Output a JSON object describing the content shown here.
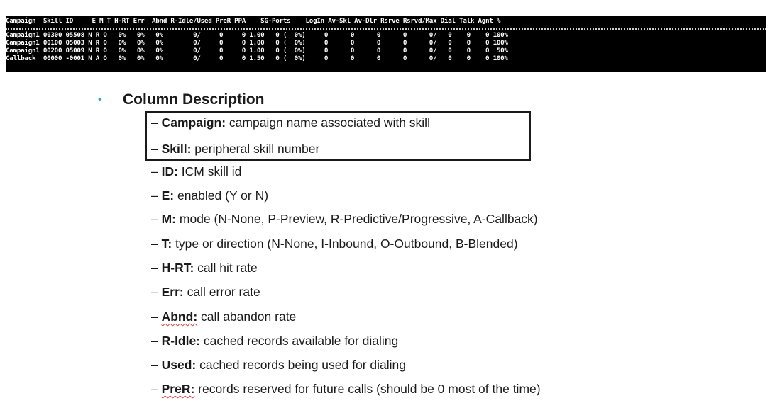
{
  "terminal": {
    "header": "Campaign  Skill ID     E M T H-RT Err  Abnd R-Idle/Used PreR PPA    SG-Ports    LogIn Av-Skl Av-Dlr Rsrve Rsrvd/Max Dial Talk Agnt %",
    "rows": [
      "Campaign1 00300 05508 N R O   0%   0%   0%        0/     0     0 1.00   0 (  0%)     0      0      0      0      0/   0    0    0 100%",
      "Campaign1 00100 05003 N R O   0%   0%   0%        0/     0     0 1.00   0 (  0%)     0      0      0      0      0/   0    0    0 100%",
      "Campaign1 00200 05009 N R O   0%   0%   0%        0/     0     0 1.00   0 (  0%)     0      0      0      0      0/   0    0    0  50%",
      "Callback  00000 -0001 N A O   0%   0%   0%        0/     0     0 1.50   0 (  0%)     0      0      0      0      0/   0    0    0 100%"
    ]
  },
  "section": {
    "bullet": "•",
    "heading": "Column Description"
  },
  "items": [
    {
      "dash": "– ",
      "term": "Campaign:",
      "desc": " campaign name associated with skill"
    },
    {
      "dash": "– ",
      "term": "Skill:",
      "desc": " peripheral skill number"
    },
    {
      "dash": "– ",
      "term": "ID:",
      "desc": " ICM skill id"
    },
    {
      "dash": "– ",
      "term": "E:",
      "desc": " enabled (Y or N)"
    },
    {
      "dash": "– ",
      "term": "M:",
      "desc": " mode (N-None, P-Preview, R-Predictive/Progressive, A-Callback)"
    },
    {
      "dash": "– ",
      "term": "T:",
      "desc": " type or direction (N-None, I-Inbound, O-Outbound, B-Blended)"
    },
    {
      "dash": "– ",
      "term": "H-RT:",
      "desc": " call hit rate"
    },
    {
      "dash": "– ",
      "term": "Err:",
      "desc": " call error rate"
    },
    {
      "dash": "– ",
      "term": "Abnd:",
      "desc": " call abandon rate"
    },
    {
      "dash": "– ",
      "term": "R-Idle:",
      "desc": " cached records available for dialing"
    },
    {
      "dash": "– ",
      "term": "Used:",
      "desc": " cached records being used for dialing"
    },
    {
      "dash": "– ",
      "term": "PreR:",
      "desc": " records reserved for future calls (should be 0 most of the time)"
    }
  ],
  "colors": {
    "terminal_bg": "#000000",
    "bullet": "#2aa5c8",
    "spellcheck": "#d94040"
  }
}
